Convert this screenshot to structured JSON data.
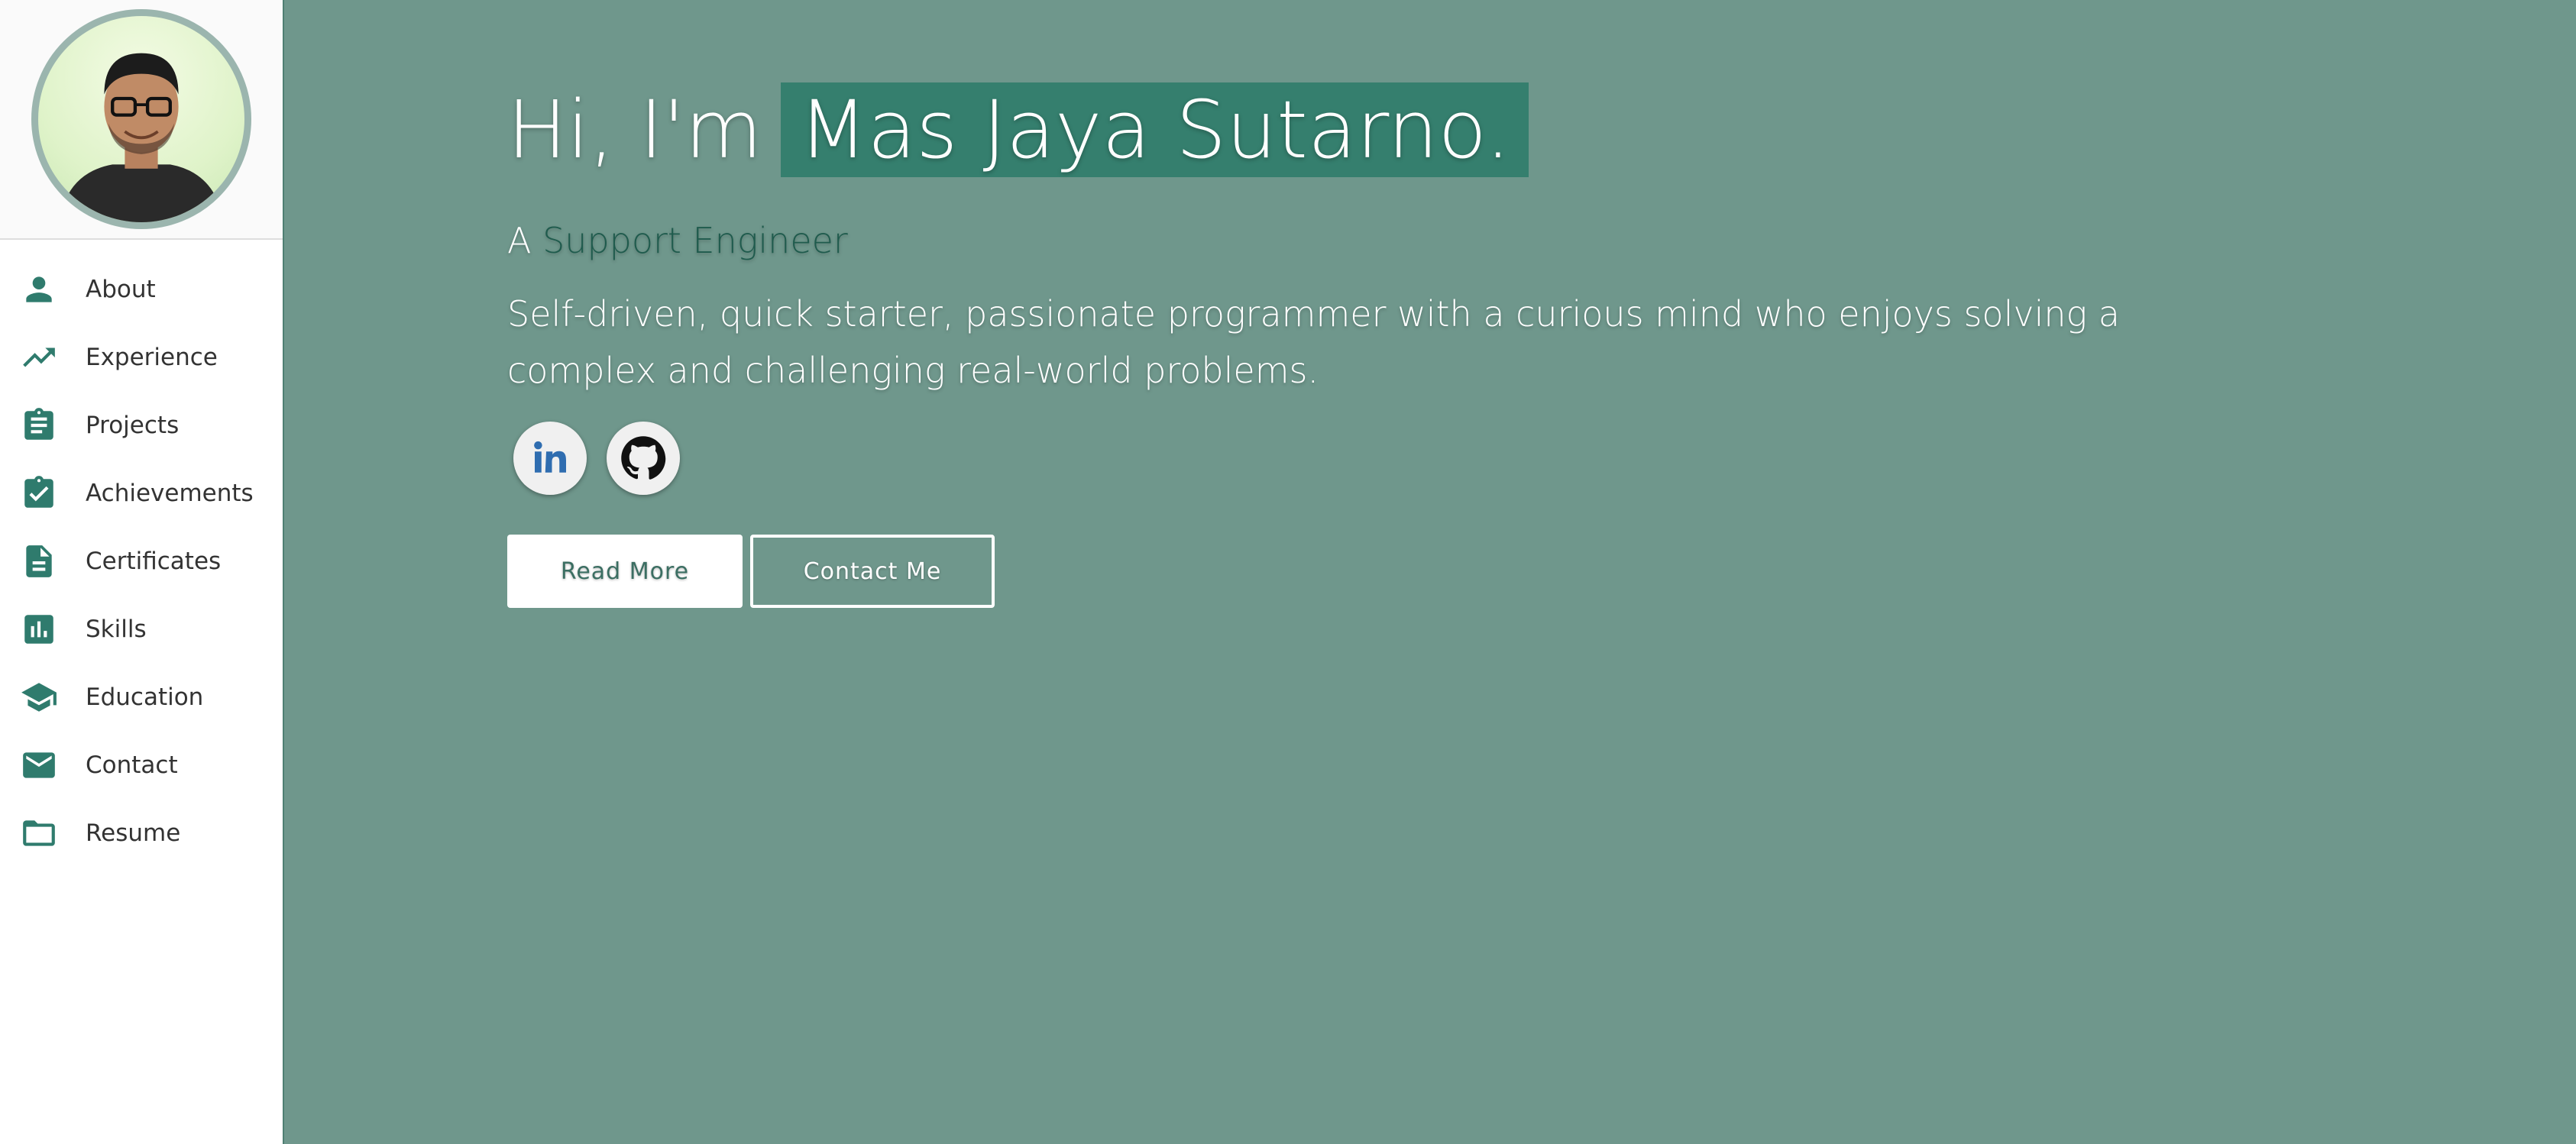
{
  "sidebar": {
    "items": [
      {
        "label": "About",
        "icon": "person-icon"
      },
      {
        "label": "Experience",
        "icon": "trending-up-icon"
      },
      {
        "label": "Projects",
        "icon": "clipboard-icon"
      },
      {
        "label": "Achievements",
        "icon": "clipboard-check-icon"
      },
      {
        "label": "Certificates",
        "icon": "document-icon"
      },
      {
        "label": "Skills",
        "icon": "bar-chart-icon"
      },
      {
        "label": "Education",
        "icon": "graduation-cap-icon"
      },
      {
        "label": "Contact",
        "icon": "mail-icon"
      },
      {
        "label": "Resume",
        "icon": "folder-icon"
      }
    ]
  },
  "hero": {
    "greeting": "Hi, I'm",
    "name": "Mas Jaya Sutarno.",
    "role_prefix": "A",
    "role": "Support Engineer",
    "bio": "Self-driven, quick starter, passionate programmer with a curious mind who enjoys solving a complex and challenging real-world problems.",
    "read_more_label": "Read More",
    "contact_label": "Contact Me"
  },
  "socials": [
    {
      "name": "linkedin-icon"
    },
    {
      "name": "github-icon"
    }
  ],
  "colors": {
    "accent": "#2f7b6d",
    "hero_bg": "#6f978c",
    "name_highlight": "#357f6e",
    "role_text": "#1f5b4d"
  }
}
